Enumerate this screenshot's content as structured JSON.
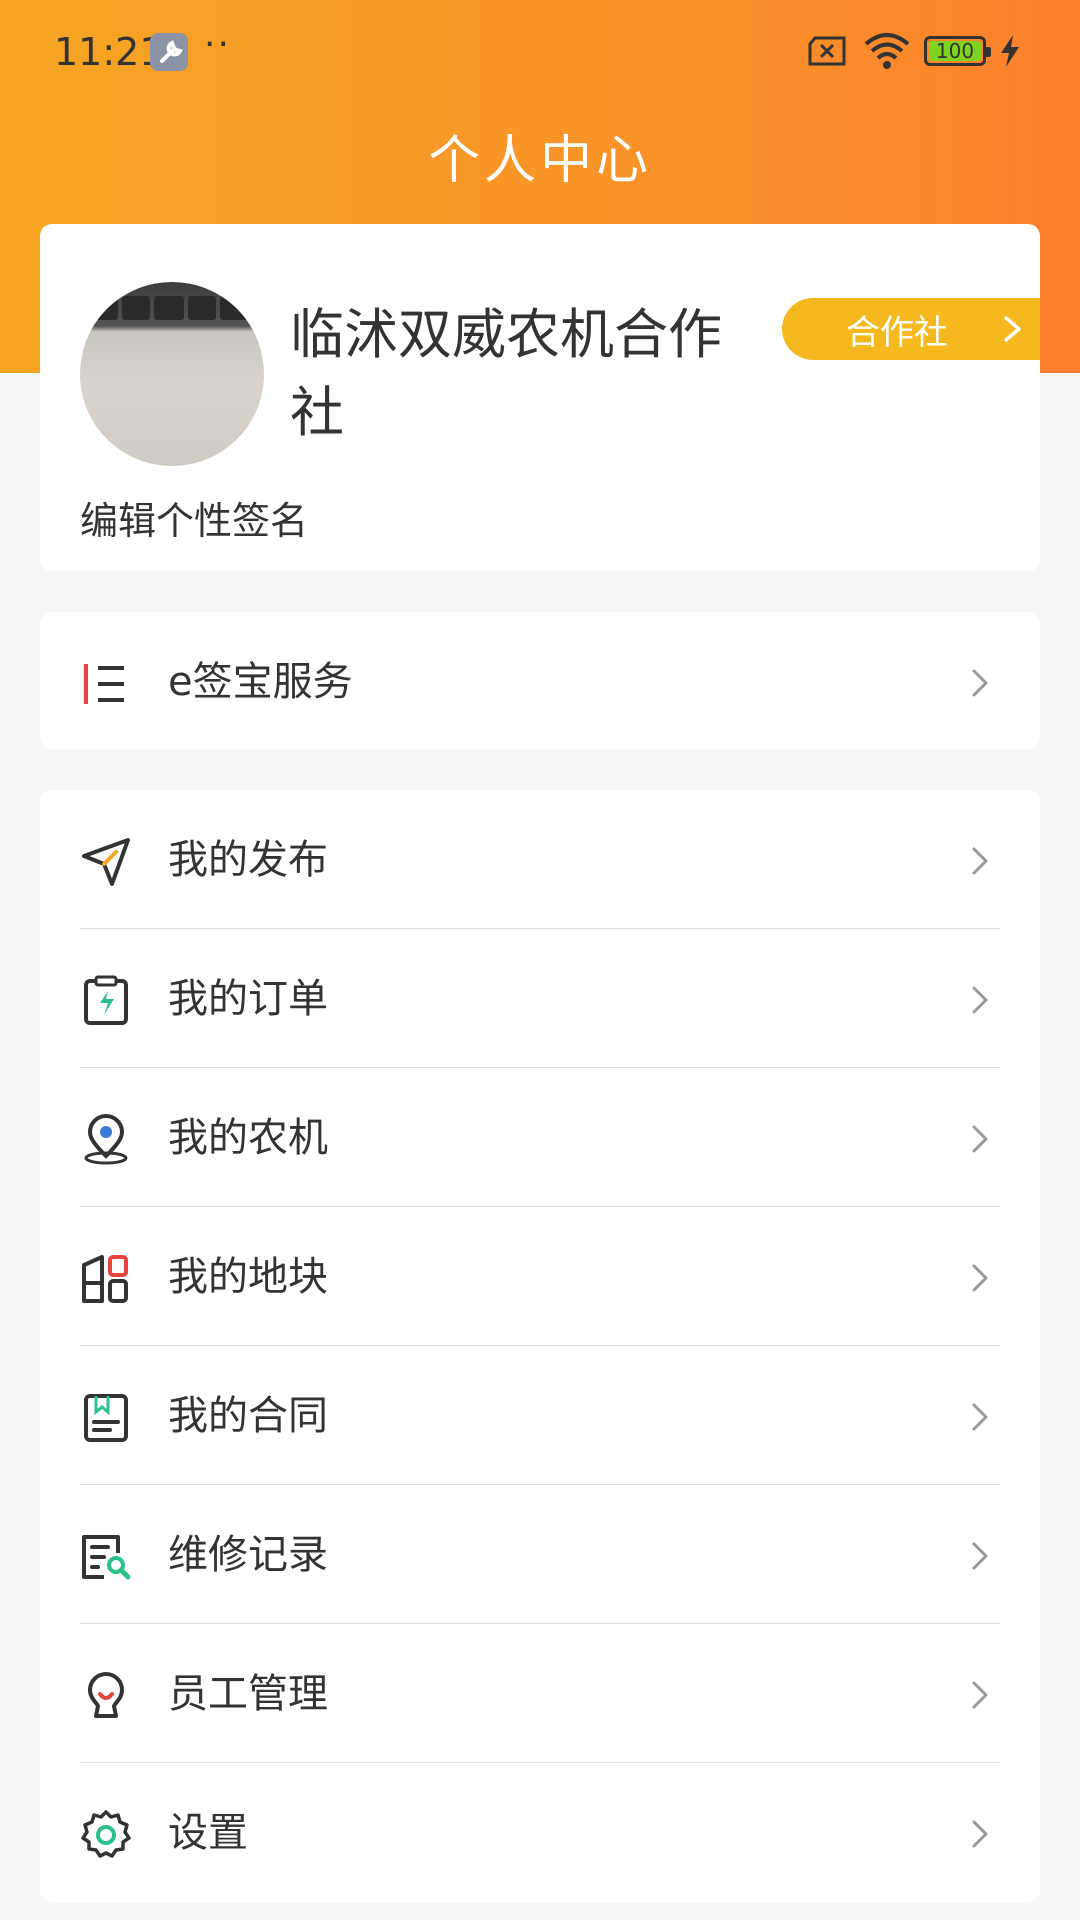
{
  "status_bar": {
    "time": "11:21",
    "dots": "··",
    "battery": "100",
    "icons": [
      "wrench-icon",
      "sim-error-icon",
      "wifi-icon",
      "battery-icon",
      "charging-bolt-icon"
    ]
  },
  "header": {
    "title": "个人中心"
  },
  "profile": {
    "name": "临沭双威农机合作社",
    "role": "合作社",
    "signature": "编辑个性签名"
  },
  "esign": {
    "label": "e签宝服务",
    "icon": "list-menu-icon"
  },
  "menu": {
    "items": [
      {
        "label": "我的发布",
        "icon": "paper-plane-icon"
      },
      {
        "label": "我的订单",
        "icon": "clipboard-bolt-icon"
      },
      {
        "label": "我的农机",
        "icon": "location-pin-icon"
      },
      {
        "label": "我的地块",
        "icon": "land-blocks-icon"
      },
      {
        "label": "我的合同",
        "icon": "contract-book-icon"
      },
      {
        "label": "维修记录",
        "icon": "repair-record-icon"
      },
      {
        "label": "员工管理",
        "icon": "employee-icon"
      },
      {
        "label": "设置",
        "icon": "gear-icon"
      }
    ]
  },
  "colors": {
    "header_start": "#f6a623",
    "header_end": "#fc7f2c",
    "badge": "#f5b81e",
    "accent_green": "#2cc08a",
    "accent_red": "#e8443f",
    "accent_blue": "#3a7bd5"
  }
}
